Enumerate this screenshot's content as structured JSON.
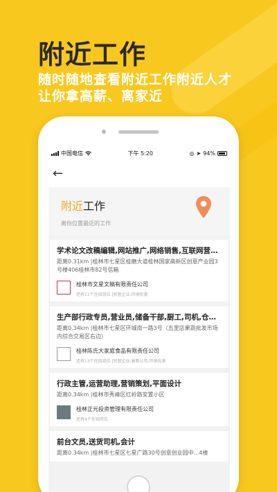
{
  "promo": {
    "headline": "附近工作",
    "subline_1": "随时随地查看附近工作附近人才",
    "subline_2": "让你拿高薪、离家近"
  },
  "status_bar": {
    "carrier": "中国电信",
    "time": "下午 5:20",
    "battery": "94%"
  },
  "hero": {
    "title_highlight": "附近",
    "title_rest": "工作",
    "subtitle": "离你位置最近的工作"
  },
  "jobs": [
    {
      "title": "学术论文改稿编辑,网站推广,网络销售,互联网营销...",
      "address": "距离0.31km |桂林市七星区桂磨大道桂林国家高新区创意产业园3号楼406桂林市82号信箱",
      "company": "桂林市文星文稿有限责任公司",
      "meta": "还有11个在招岗位 |民营企业,环境优美"
    },
    {
      "title": "生产部行政专员,营业员,储备干部,厨工,司机,仓库搬...",
      "address": "距离0.34km |桂林市七星区环城南一路3号（五里店果蔬批发市场内综合交易区右边）",
      "company": "桂林陈氏大家庭食品有限责任公司",
      "meta": "还有13个在招岗位 |民营企业,高薪公司,环境优美"
    },
    {
      "title": "行政主管,运营助理,营销策划,平面设计",
      "address": "距离0.34km |桂林市秀峰区红岭路安置小区",
      "company": "桂林正元投资管理有限责任公司",
      "meta": "还有4个在招岗位"
    },
    {
      "title": "前台文员,送货司机,会计",
      "address": "距离0.34km |桂林市七星区七星广路30号创意创业园中...4楼",
      "company": "",
      "meta": ""
    }
  ],
  "colors": {
    "background": "#f9c81e",
    "accent": "#f5a623",
    "pin": "#f08d5a"
  },
  "icons": [
    "back-arrow-icon",
    "map-pin-icon",
    "wifi-icon",
    "signal-icon",
    "battery-icon",
    "location-arrow-icon"
  ]
}
